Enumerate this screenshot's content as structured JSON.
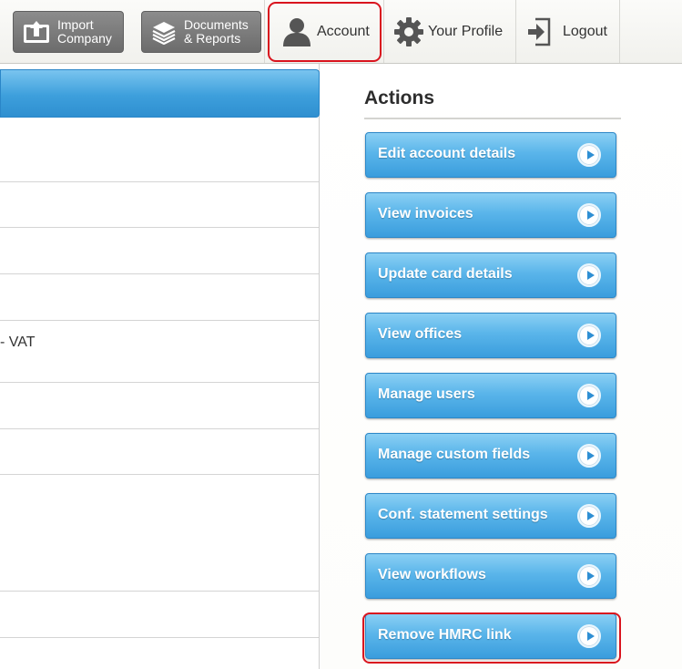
{
  "topbar": {
    "import_line1": "Import",
    "import_line2": "Company",
    "docs_line1": "Documents",
    "docs_line2": "& Reports",
    "account": "Account",
    "profile": "Your Profile",
    "logout": "Logout"
  },
  "content": {
    "row_vat": "- VAT"
  },
  "actions": {
    "title": "Actions",
    "items": [
      {
        "label": "Edit account details"
      },
      {
        "label": "View invoices"
      },
      {
        "label": "Update card details"
      },
      {
        "label": "View offices"
      },
      {
        "label": "Manage users"
      },
      {
        "label": "Manage custom fields"
      },
      {
        "label": "Conf. statement settings"
      },
      {
        "label": "View workflows"
      },
      {
        "label": "Remove HMRC link"
      }
    ]
  },
  "colors": {
    "accent_blue": "#3a9ddd",
    "highlight_red": "#d9141e",
    "dark_button": "#6c6c6c"
  },
  "icons": {
    "import": "upload-box-icon",
    "documents": "document-stack-icon",
    "account": "user-silhouette-icon",
    "profile": "gear-icon",
    "logout": "logout-arrow-icon",
    "action_arrow": "circle-arrow-right-icon"
  }
}
